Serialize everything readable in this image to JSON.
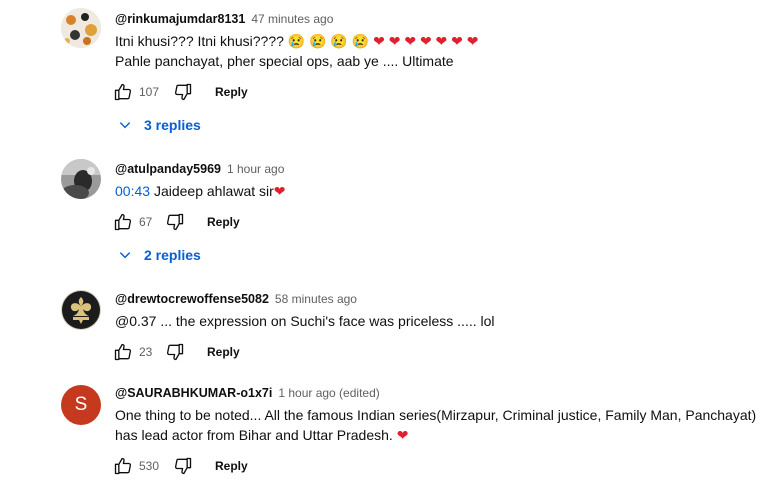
{
  "comments": [
    {
      "author": "@rinkumajumdar8131",
      "time": "47 minutes ago",
      "line1": "Itni khusi??? Itni khusi????",
      "line1_emojis": "😢 😢 😢 😢",
      "line1_hearts": "❤ ❤ ❤ ❤ ❤ ❤ ❤",
      "line2": "Pahle panchayat, pher special ops, aab ye .... Ultimate",
      "likes": "107",
      "reply_label": "Reply",
      "replies_label": "3 replies"
    },
    {
      "author": "@atulpanday5969",
      "time": "1 hour ago",
      "timestamp_link": "00:43",
      "line1": "Jaideep ahlawat sir",
      "line1_hearts": "❤",
      "likes": "67",
      "reply_label": "Reply",
      "replies_label": "2 replies"
    },
    {
      "author": "@drewtocrewoffense5082",
      "time": "58 minutes ago",
      "line1": "@0.37 ... the expression on Suchi's face was priceless ..... lol",
      "likes": "23",
      "reply_label": "Reply"
    },
    {
      "author": "@SAURABHKUMAR-o1x7i",
      "time": "1 hour ago (edited)",
      "avatar_letter": "S",
      "line1": "One thing to be noted... All the famous Indian series(Mirzapur, Criminal justice, Family Man, Panchayat)",
      "line2": "has lead actor from Bihar and Uttar Pradesh.",
      "line2_hearts": "❤",
      "likes": "530",
      "reply_label": "Reply"
    }
  ],
  "colors": {
    "link": "#065fd4",
    "avatar_s": "#c5391f",
    "heart": "#e0202e"
  }
}
